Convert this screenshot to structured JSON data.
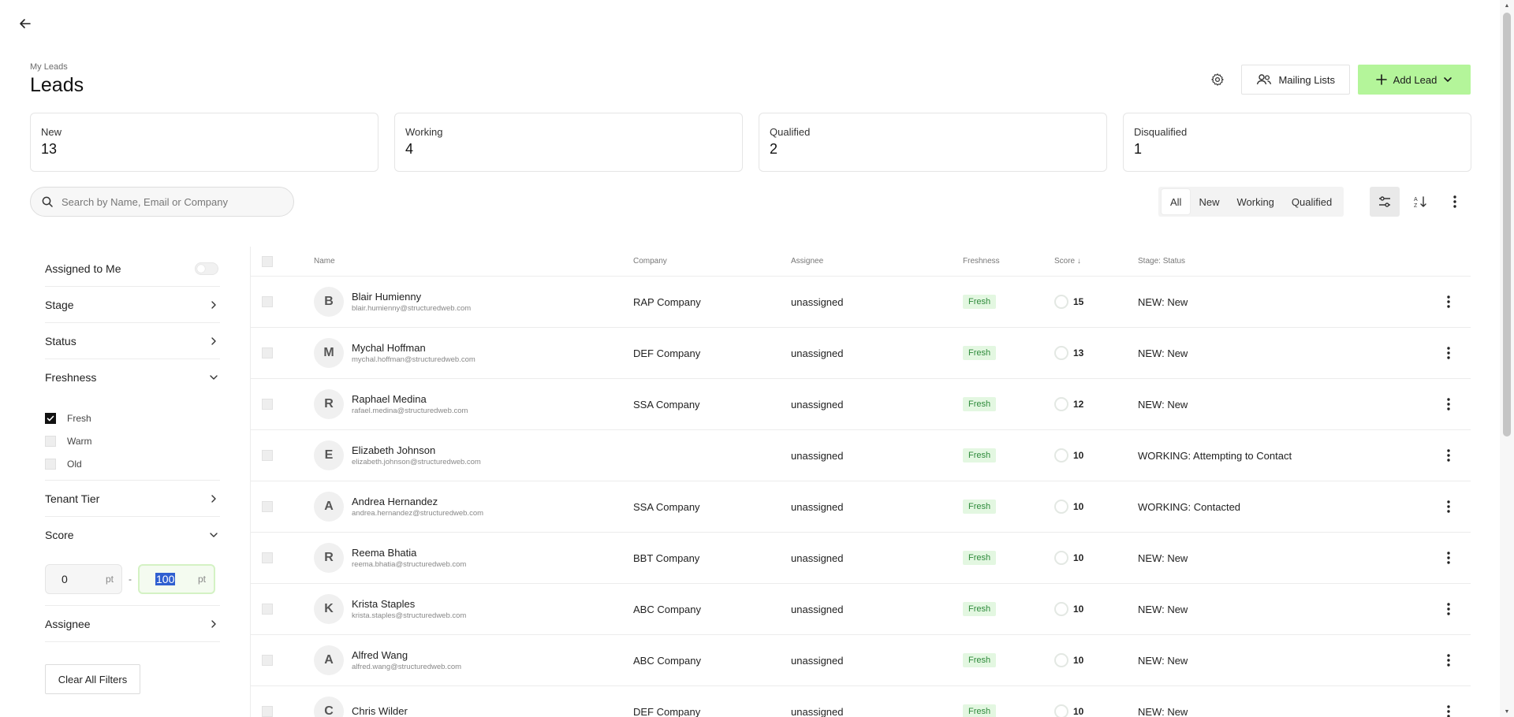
{
  "header": {
    "back_icon": "arrow-left-icon",
    "breadcrumb": "My Leads",
    "title": "Leads",
    "mailing_lists_label": "Mailing Lists",
    "add_lead_label": "Add Lead"
  },
  "stats": [
    {
      "label": "New",
      "value": "13"
    },
    {
      "label": "Working",
      "value": "4"
    },
    {
      "label": "Qualified",
      "value": "2"
    },
    {
      "label": "Disqualified",
      "value": "1"
    }
  ],
  "search": {
    "placeholder": "Search by Name, Email or Company"
  },
  "filter_tabs": [
    "All",
    "New",
    "Working",
    "Qualified"
  ],
  "active_tab": "All",
  "sidebar": {
    "assigned_to_me": "Assigned to Me",
    "stage": "Stage",
    "status": "Status",
    "freshness": "Freshness",
    "freshness_options": [
      {
        "label": "Fresh",
        "checked": true
      },
      {
        "label": "Warm",
        "checked": false
      },
      {
        "label": "Old",
        "checked": false
      }
    ],
    "tenant_tier": "Tenant Tier",
    "score": "Score",
    "score_min": "0",
    "score_max": "100",
    "score_unit": "pt",
    "range_separator": "-",
    "assignee": "Assignee",
    "clear_all": "Clear All Filters"
  },
  "table": {
    "headers": {
      "name": "Name",
      "company": "Company",
      "assignee": "Assignee",
      "freshness": "Freshness",
      "score": "Score ↓",
      "status": "Stage: Status"
    },
    "rows": [
      {
        "initial": "B",
        "name": "Blair Humienny",
        "email": "blair.humienny@structuredweb.com",
        "company": "RAP Company",
        "assignee": "unassigned",
        "freshness": "Fresh",
        "score": "15",
        "status": "NEW: New"
      },
      {
        "initial": "M",
        "name": "Mychal Hoffman",
        "email": "mychal.hoffman@structuredweb.com",
        "company": "DEF Company",
        "assignee": "unassigned",
        "freshness": "Fresh",
        "score": "13",
        "status": "NEW: New"
      },
      {
        "initial": "R",
        "name": "Raphael Medina",
        "email": "rafael.medina@structuredweb.com",
        "company": "SSA Company",
        "assignee": "unassigned",
        "freshness": "Fresh",
        "score": "12",
        "status": "NEW: New"
      },
      {
        "initial": "E",
        "name": "Elizabeth Johnson",
        "email": "elizabeth.johnson@structuredweb.com",
        "company": "",
        "assignee": "unassigned",
        "freshness": "Fresh",
        "score": "10",
        "status": "WORKING: Attempting to Contact"
      },
      {
        "initial": "A",
        "name": "Andrea Hernandez",
        "email": "andrea.hernandez@structuredweb.com",
        "company": "SSA Company",
        "assignee": "unassigned",
        "freshness": "Fresh",
        "score": "10",
        "status": "WORKING: Contacted"
      },
      {
        "initial": "R",
        "name": "Reema Bhatia",
        "email": "reema.bhatia@structuredweb.com",
        "company": "BBT Company",
        "assignee": "unassigned",
        "freshness": "Fresh",
        "score": "10",
        "status": "NEW: New"
      },
      {
        "initial": "K",
        "name": "Krista Staples",
        "email": "krista.staples@structuredweb.com",
        "company": "ABC Company",
        "assignee": "unassigned",
        "freshness": "Fresh",
        "score": "10",
        "status": "NEW: New"
      },
      {
        "initial": "A",
        "name": "Alfred Wang",
        "email": "alfred.wang@structuredweb.com",
        "company": "ABC Company",
        "assignee": "unassigned",
        "freshness": "Fresh",
        "score": "10",
        "status": "NEW: New"
      },
      {
        "initial": "C",
        "name": "Chris Wilder",
        "email": "",
        "company": "DEF Company",
        "assignee": "unassigned",
        "freshness": "Fresh",
        "score": "10",
        "status": "NEW: New"
      }
    ]
  },
  "colors": {
    "accent_green": "#b4f59a",
    "fresh_badge_bg": "#e3f7e1",
    "fresh_badge_text": "#2d8a3a"
  }
}
